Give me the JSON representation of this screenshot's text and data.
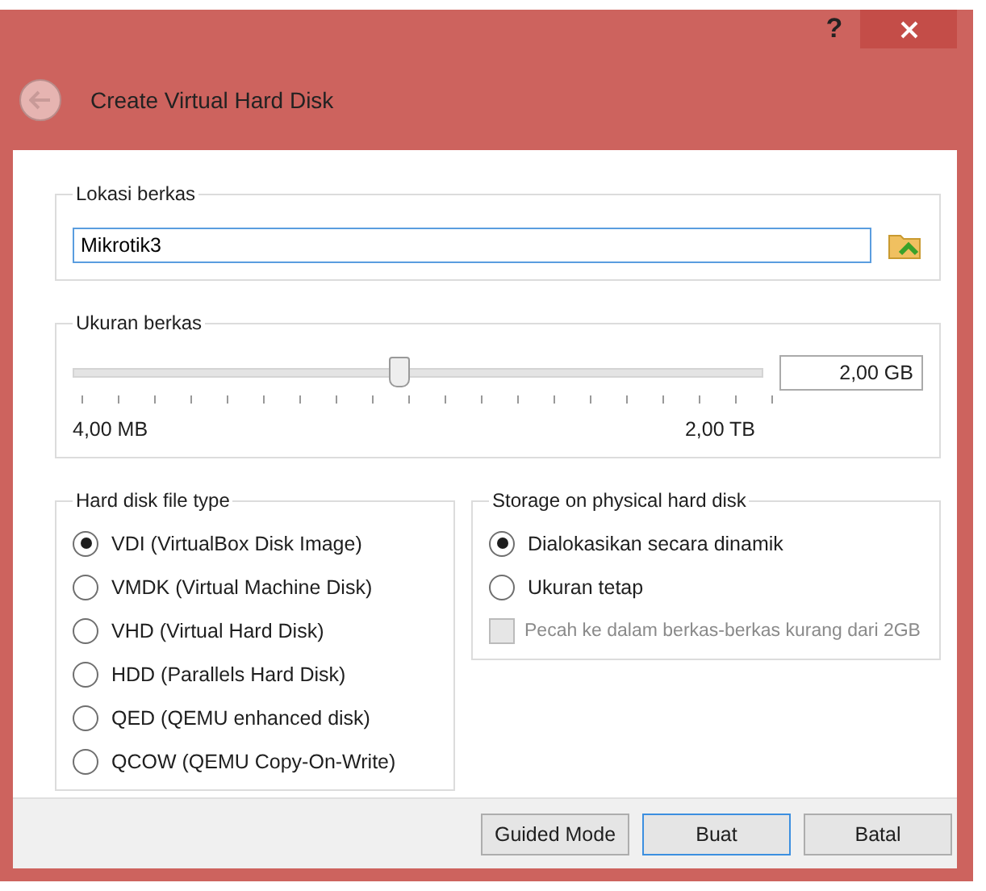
{
  "window": {
    "help": "?",
    "title": "Create Virtual Hard Disk"
  },
  "location": {
    "label": "Lokasi berkas",
    "value": "Mikrotik3"
  },
  "size": {
    "label": "Ukuran berkas",
    "level": 0.47,
    "value": "2,00 GB",
    "min_label": "4,00 MB",
    "max_label": "2,00 TB"
  },
  "file_type": {
    "label": "Hard disk file type",
    "options": [
      {
        "label": "VDI (VirtualBox Disk Image)",
        "selected": true
      },
      {
        "label": "VMDK (Virtual Machine Disk)",
        "selected": false
      },
      {
        "label": "VHD (Virtual Hard Disk)",
        "selected": false
      },
      {
        "label": "HDD (Parallels Hard Disk)",
        "selected": false
      },
      {
        "label": "QED (QEMU enhanced disk)",
        "selected": false
      },
      {
        "label": "QCOW (QEMU Copy-On-Write)",
        "selected": false
      }
    ]
  },
  "storage": {
    "label": "Storage on physical hard disk",
    "options": [
      {
        "label": "Dialokasikan secara dinamik",
        "selected": true
      },
      {
        "label": "Ukuran tetap",
        "selected": false
      }
    ],
    "split": {
      "label": "Pecah ke dalam berkas-berkas kurang dari 2GB",
      "checked": false,
      "disabled": true
    }
  },
  "buttons": [
    {
      "label": "Guided Mode",
      "default": false
    },
    {
      "label": "Buat",
      "default": true
    },
    {
      "label": "Batal",
      "default": false
    }
  ]
}
